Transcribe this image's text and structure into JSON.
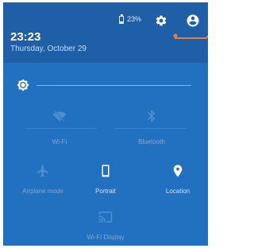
{
  "status_bar": {
    "battery_percent": "23%",
    "battery_icon": "battery-icon",
    "settings_icon": "gear-icon",
    "account_icon": "account-circle-icon"
  },
  "header": {
    "time": "23:23",
    "date": "Thursday, October 29"
  },
  "brightness": {
    "icon": "brightness-icon",
    "level_fraction": 1.0
  },
  "tiles": [
    {
      "label": "Wi-Fi",
      "icon": "wifi-off-icon",
      "state": "off"
    },
    {
      "label": "Bluetooth",
      "icon": "bluetooth-icon",
      "state": "off"
    },
    {
      "label": "Airplane mode",
      "icon": "airplane-icon",
      "state": "off"
    },
    {
      "label": "Portrait",
      "icon": "portrait-icon",
      "state": "on"
    },
    {
      "label": "Location",
      "icon": "location-pin-icon",
      "state": "on"
    },
    {
      "label": "Wi-Fi Display",
      "icon": "cast-icon",
      "state": "off"
    }
  ],
  "colors": {
    "panel_bg": "#2270c0",
    "header_bg": "#1e5fa8",
    "annotation": "#e8803a",
    "active_icon": "#ffffff",
    "inactive_icon": "#4e8fd0"
  }
}
